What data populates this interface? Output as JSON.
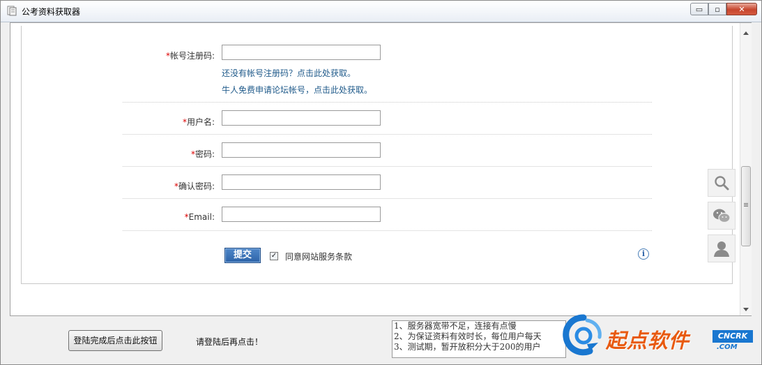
{
  "window": {
    "title": "公考资料获取器",
    "minimize": "▭",
    "restore": "▫",
    "close": "✕"
  },
  "form": {
    "register_code_label": "帐号注册码:",
    "no_code_link": "还没有帐号注册码？点击此处获取。",
    "free_apply_link": "牛人免费申请论坛帐号，点击此处获取。",
    "username_label": "用户名:",
    "password_label": "密码:",
    "confirm_password_label": "确认密码:",
    "email_label": "Email:",
    "required_mark": "*",
    "submit_label": "提交",
    "agree_label": "同意网站服务条款",
    "agree_checked": "✓",
    "info_glyph": "i"
  },
  "bottom": {
    "login_button": "登陆完成后点击此按钮",
    "hint": "请登陆后再点击！",
    "notes": [
      "1、服务器宽带不足，连接有点慢",
      "2、为保证资料有效时长，每位用户每天",
      "3、测试期，暂开放积分大于200的用户"
    ]
  },
  "watermark": {
    "name": "起点软件",
    "badge": "CNCRK",
    "domain": ".COM"
  },
  "icons": {
    "search": "search-icon",
    "wechat": "wechat-icon",
    "user": "user-icon"
  }
}
